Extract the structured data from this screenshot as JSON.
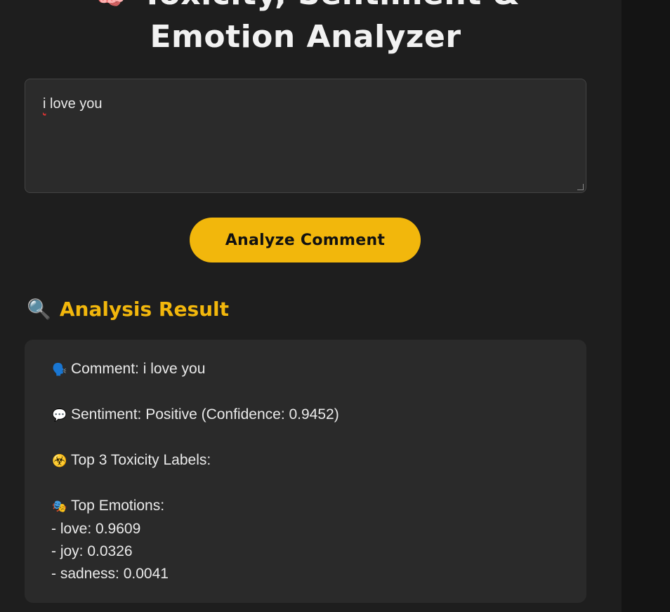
{
  "app": {
    "title_line1": "Toxicity, Sentiment &",
    "title_line2": "Emotion Analyzer"
  },
  "input": {
    "value": "i love you",
    "first_word": "i",
    "rest": " love you"
  },
  "actions": {
    "analyze_label": "Analyze Comment"
  },
  "result": {
    "heading": "Analysis Result",
    "comment_line": "Comment: i love you",
    "sentiment_line": "Sentiment: Positive (Confidence: 0.9452)",
    "toxicity_heading": "Top 3 Toxicity Labels:",
    "emotions_heading": "Top Emotions:",
    "emotions": [
      "- love: 0.9609",
      "- joy: 0.0326",
      "- sadness: 0.0041"
    ]
  },
  "icons": {
    "brain": "brain-icon",
    "magnifier": "magnifying-glass-icon",
    "comment": "speaking-head-icon",
    "sentiment": "speech-bubble-icon",
    "toxicity": "biohazard-icon",
    "emotions": "theater-masks-icon"
  },
  "colors": {
    "accent": "#f2b70c",
    "panel": "#1e1e1e",
    "card": "#2a2a2a",
    "text": "#eaeaea"
  }
}
